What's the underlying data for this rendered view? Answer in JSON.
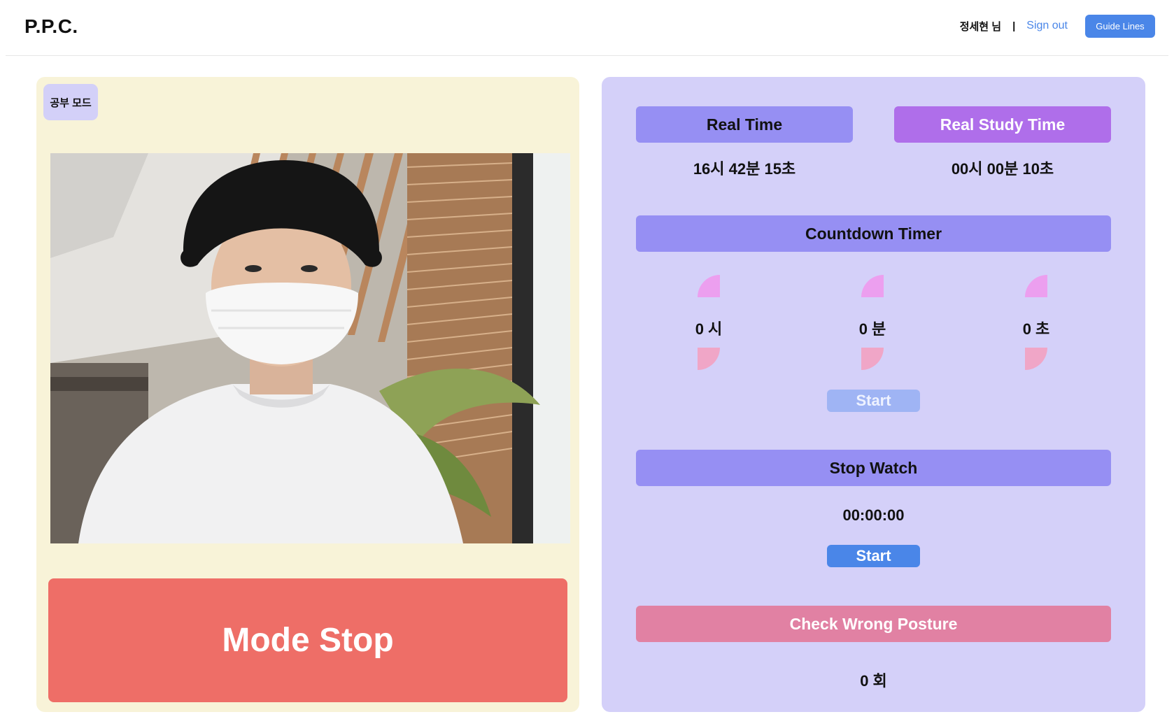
{
  "header": {
    "brand": "P.P.C.",
    "user": "정세현 님",
    "separator": "|",
    "sign_out": "Sign out",
    "guide": "Guide Lines"
  },
  "left": {
    "mode_badge": "공부 모드",
    "mode_stop": "Mode Stop"
  },
  "right": {
    "real_time": {
      "label": "Real Time",
      "value": "16시 42분 15초"
    },
    "study_time": {
      "label": "Real Study Time",
      "value": "00시 00분 10초"
    },
    "countdown": {
      "label": "Countdown Timer",
      "hours": "0 시",
      "minutes": "0 분",
      "seconds": "0 초",
      "start": "Start"
    },
    "stopwatch": {
      "label": "Stop Watch",
      "value": "00:00:00",
      "start": "Start"
    },
    "posture": {
      "label": "Check Wrong Posture",
      "count": "0 회"
    }
  },
  "colors": {
    "accent_blue": "#4a86e8",
    "left_panel": "#f8f3d8",
    "right_panel": "#d4d0f9",
    "section_bar": "#968ff3",
    "study_bar": "#af6eea",
    "posture_bar": "#e181a3",
    "mode_stop": "#ee6e67"
  },
  "icons": {
    "up": "increment-arrow-icon",
    "down": "decrement-arrow-icon"
  }
}
